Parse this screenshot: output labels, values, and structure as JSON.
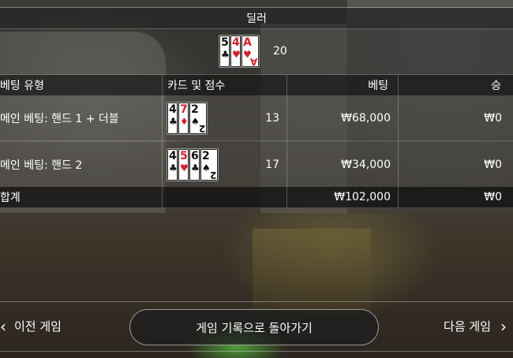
{
  "dealer": {
    "label": "딜러",
    "cards": [
      {
        "rank": "5",
        "suit": "♣",
        "color": "#111111"
      },
      {
        "rank": "4",
        "suit": "♥",
        "color": "#d4202c"
      },
      {
        "rank": "A",
        "suit": "♥",
        "color": "#d4202c"
      }
    ],
    "score": "20"
  },
  "table": {
    "headers": {
      "type": "베팅 유형",
      "cards": "카드 및 점수",
      "bet": "베팅",
      "win": "승"
    },
    "rows": [
      {
        "type": "메인 베팅: 핸드 1 + 더블",
        "cards": [
          {
            "rank": "4",
            "suit": "♣",
            "color": "#111111"
          },
          {
            "rank": "7",
            "suit": "♦",
            "color": "#d4202c"
          },
          {
            "rank": "2",
            "suit": "♠",
            "color": "#111111"
          }
        ],
        "score": "13",
        "bet": "₩68,000",
        "win": "₩0"
      },
      {
        "type": "메인 베팅: 핸드 2",
        "cards": [
          {
            "rank": "4",
            "suit": "♣",
            "color": "#111111"
          },
          {
            "rank": "5",
            "suit": "♥",
            "color": "#d4202c"
          },
          {
            "rank": "6",
            "suit": "♣",
            "color": "#111111"
          },
          {
            "rank": "2",
            "suit": "♠",
            "color": "#111111"
          }
        ],
        "score": "17",
        "bet": "₩34,000",
        "win": "₩0"
      }
    ],
    "total": {
      "label": "합계",
      "bet": "₩102,000",
      "win": "₩0"
    }
  },
  "nav": {
    "prev_label": "이전 게임",
    "back_label": "게임 기록으로 돌아가기",
    "next_label": "다음 게임",
    "prev_icon": "chevron-left-icon",
    "next_icon": "chevron-right-icon"
  }
}
